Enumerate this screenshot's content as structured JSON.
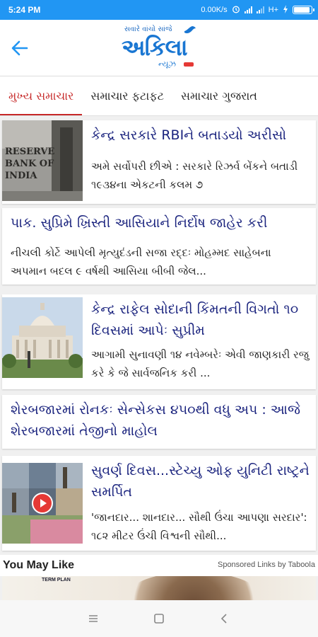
{
  "status_bar": {
    "time": "5:24 PM",
    "speed": "0.00K/s",
    "icons": [
      "alarm-icon",
      "signal-icon",
      "signal-icon",
      "hplus-icon",
      "battery-icon"
    ],
    "network": "H+"
  },
  "header": {
    "logo_tagline": "સવારે વાંચો સાંજે",
    "logo_name": "અકિલા",
    "logo_sub": "ન્યૂઝ"
  },
  "tabs": [
    {
      "label": "મુખ્ય સમાચાર",
      "active": true
    },
    {
      "label": "સમાચાર ફટાફટ",
      "active": false
    },
    {
      "label": "સમાચાર ગુજરાત",
      "active": false
    }
  ],
  "articles": [
    {
      "title": "કેન્દ્ર સરકારે RBIને બતાડયો અરીસો",
      "desc": "અમે સર્વોપરી છીએ : સરકારે રિઝર્વ બેંકને બતાડી ૧૯૩૪ના એકટની કલમ ૭",
      "thumb_text": "RESERVE BANK OF INDIA"
    },
    {
      "title": "પાક. સુપ્રિમે ખ્રિસ્તી આસિયાને નિર્દોષ જાહેર કરી",
      "desc": "નીચલી કોર્ટે આપેલી મૃત્યુદંડની સજા રદ્દઃ મોહમ્મદ સાહેબના અપમાન બદલ ૯ વર્ષથી આસિયા બીબી જેલ..."
    },
    {
      "title": "કેન્દ્ર રાફેલ સોદાની કિંમતની વિગતો ૧૦ દિવસમાં આપેઃ સુપ્રીમ",
      "desc": "આગામી સુનાવણી ૧૪ નવેમ્બરેઃ એવી જાણકારી રજુ કરે કે જે સાર્વજનિક કરી ..."
    },
    {
      "title": "શેરબજારમાં રોનકઃ સેન્સેકસ ૪૫૦થી વધુ અપ : આજે શેરબજારમાં તેજીનો માહોલ"
    },
    {
      "title": "સુવર્ણ દિવસ...સ્ટેચ્યુ ઓફ યુનિટી રાષ્ટ્રને સમર્પિત",
      "desc": "'જાનદાર... શાનદાર... સૌથી ઉંચા આપણા સરદાર': ૧૮૨ મીટર ઉંચી વિશ્વની સૌથી..."
    }
  ],
  "you_may_like": {
    "heading": "You May Like",
    "sponsored": "Sponsored Links by Taboola",
    "ad_text": "TERM PLAN"
  },
  "colors": {
    "status_bar": "#2196f3",
    "title": "#1a237e",
    "active_tab": "#c62828",
    "logo": "#1976d2"
  }
}
